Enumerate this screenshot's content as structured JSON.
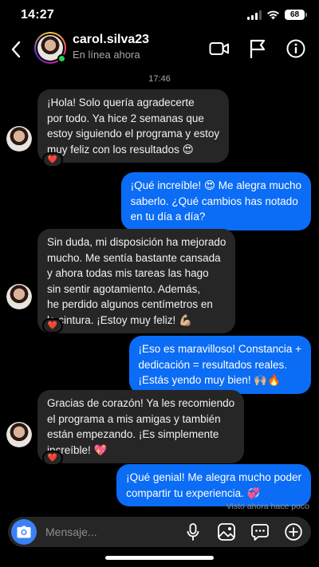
{
  "status_bar": {
    "time": "14:27",
    "battery": "68"
  },
  "header": {
    "username": "carol.silva23",
    "status": "En línea ahora"
  },
  "thread": {
    "timestamp": "17:46",
    "messages": [
      {
        "direction": "in",
        "lines": [
          "¡Hola! Solo quería agradecerte",
          "por todo. Ya hice 2 semanas que",
          "estoy siguiendo el programa y estoy",
          "muy feliz con los resultados 😍"
        ],
        "reaction": "❤️"
      },
      {
        "direction": "out",
        "lines": [
          "¡Qué increíble! 😍 Me alegra mucho",
          "saberlo. ¿Qué cambios has notado",
          "en tu día a día?"
        ]
      },
      {
        "direction": "in",
        "lines": [
          "Sin duda, mi disposición ha mejorado",
          "mucho. Me sentía bastante cansada",
          "y ahora todas mis tareas las hago",
          "sin sentir agotamiento. Además,",
          "he perdido algunos centímetros en",
          "la cintura. ¡Estoy muy feliz! 💪🏼"
        ],
        "reaction": "❤️"
      },
      {
        "direction": "out",
        "lines": [
          "¡Eso es maravilloso! Constancia +",
          "dedicación = resultados reales.",
          "¡Estás yendo muy bien! 🙌🏼🔥"
        ]
      },
      {
        "direction": "in",
        "lines": [
          "Gracias de corazón! Ya les recomiendo",
          "el programa a mis amigas y también",
          "están empezando. ¡Es simplemente",
          "increíble! 💖"
        ],
        "reaction": "❤️"
      },
      {
        "direction": "out",
        "lines": [
          "¡Qué genial! Me alegra mucho poder",
          "compartir tu experiencia. 💞"
        ]
      }
    ],
    "seen": "Visto ahora hace poco"
  },
  "composer": {
    "placeholder": "Mensaje..."
  },
  "icons": {
    "back": "chevron-left-icon",
    "video": "video-camera-icon",
    "flag": "flag-icon",
    "info": "info-icon",
    "camera": "camera-icon",
    "mic": "microphone-icon",
    "gallery": "image-icon",
    "sticker": "chat-bubble-icon",
    "add": "plus-circle-icon"
  },
  "colors": {
    "outgoing_bubble": "#0b6cf5",
    "incoming_bubble": "#262626",
    "online": "#1fd84e",
    "camera_button": "#3b80f5"
  }
}
